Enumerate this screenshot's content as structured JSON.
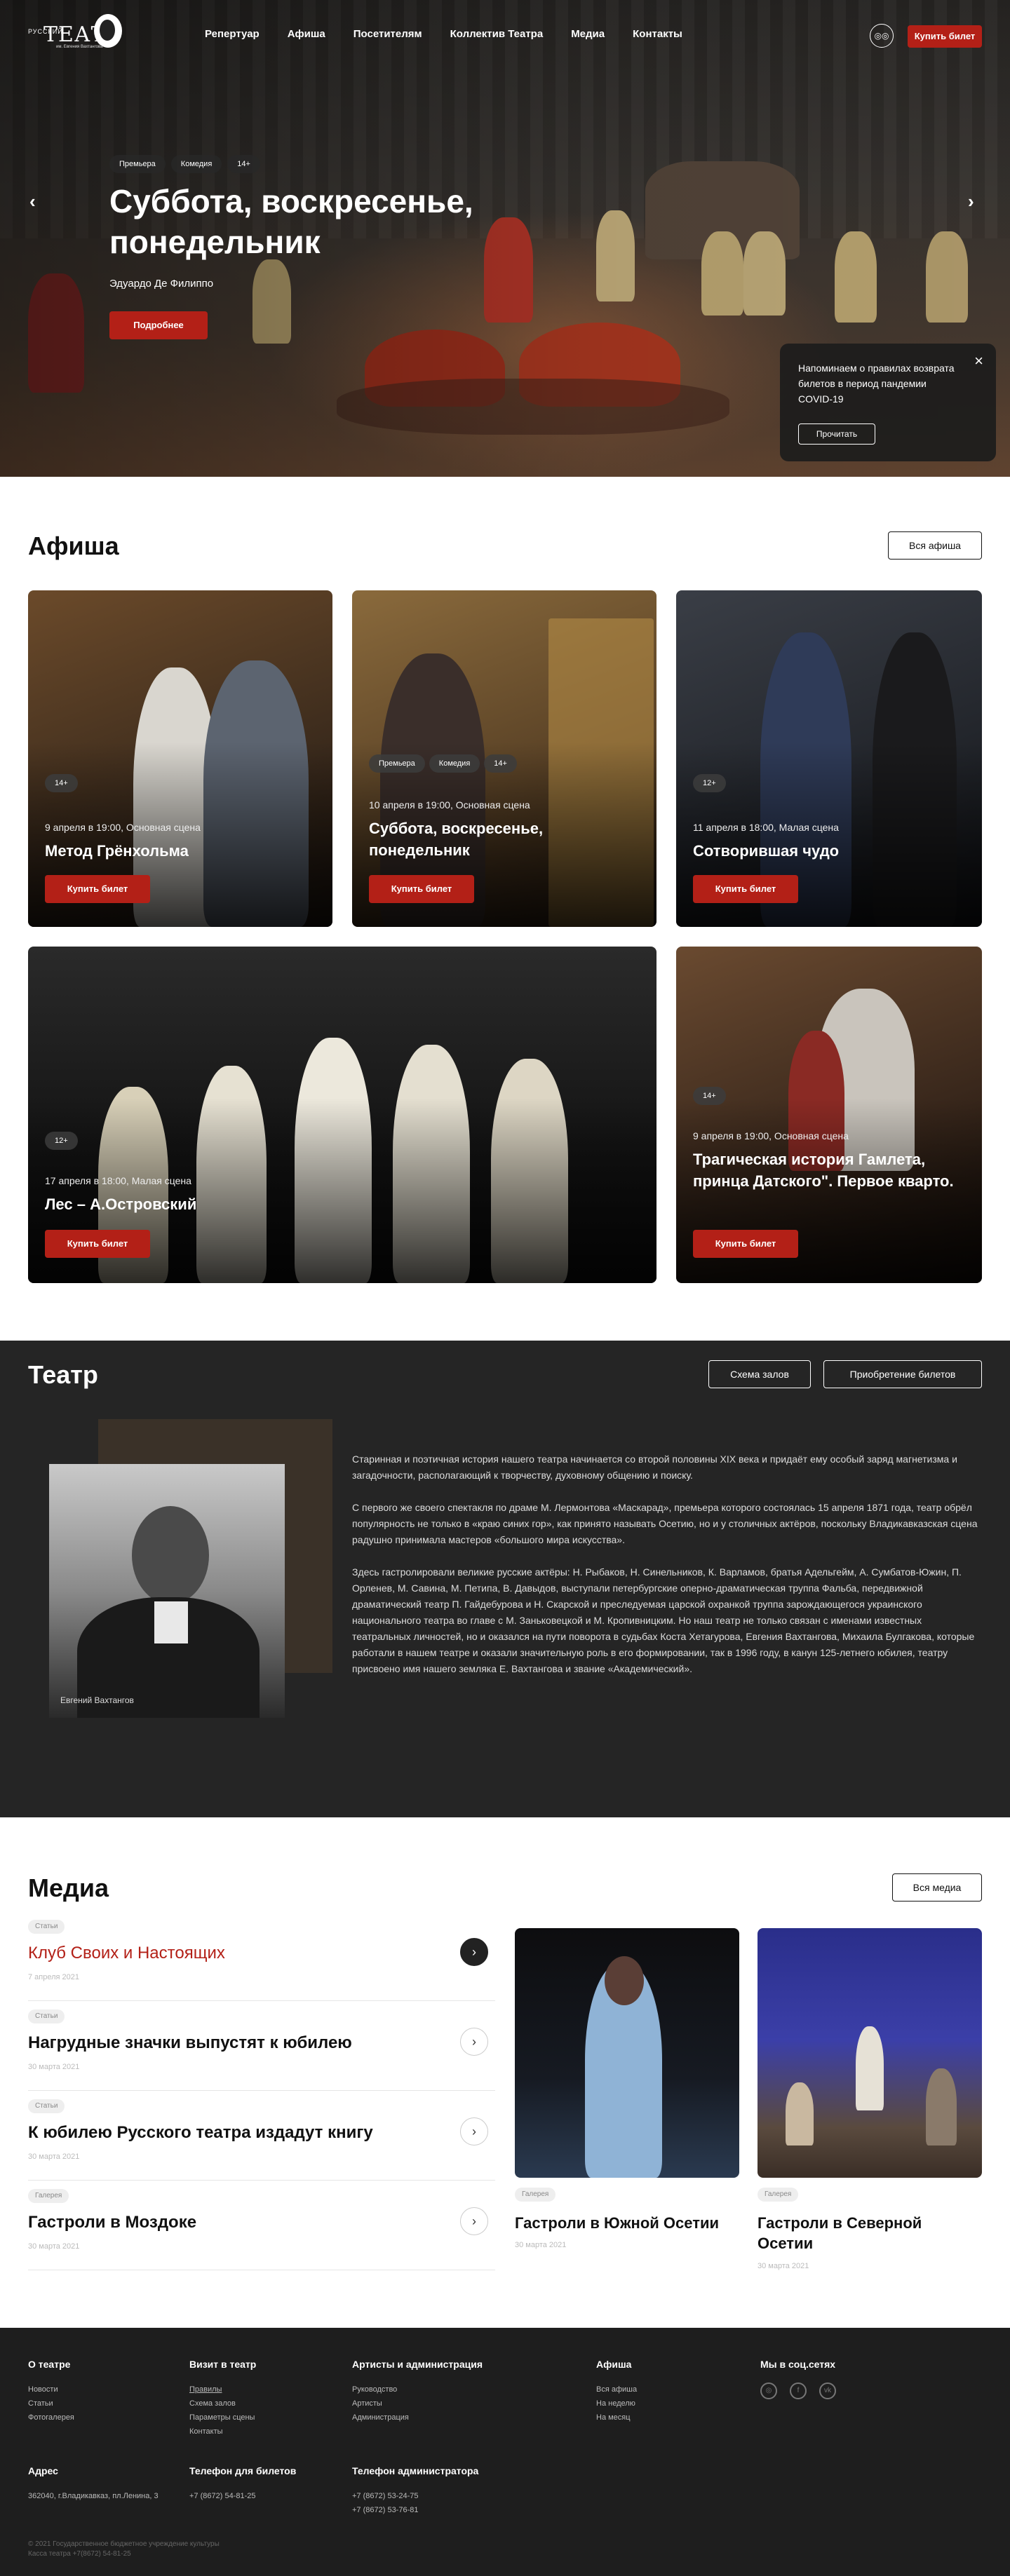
{
  "header": {
    "logo": {
      "small": "РУССКИЙ",
      "big": "ТЕАТР",
      "sub": "им. Евгения Вахтангова"
    },
    "nav": [
      "Репертуар",
      "Афиша",
      "Посетителям",
      "Коллектив Театра",
      "Медиа",
      "Контакты"
    ],
    "accessibility_icon": "glasses-icon",
    "buy_ticket": "Купить билет"
  },
  "hero": {
    "tags": [
      "Премьера",
      "Комедия",
      "14+"
    ],
    "title": "Суббота, воскресенье, понедельник",
    "author": "Эдуардо Де Филиппо",
    "more": "Подробнее",
    "prev": "‹",
    "next": "›"
  },
  "notice": {
    "text": "Напоминаем о правилах возврата билетов в период пандемии COVID-19",
    "read": "Прочитать",
    "close": "×"
  },
  "afisha": {
    "title": "Афиша",
    "all": "Вся афиша",
    "cards": [
      {
        "tags": [
          "14+"
        ],
        "date": "9 апреля в 19:00, Основная сцена",
        "title": "Метод Грёнхольма",
        "buy": "Купить билет"
      },
      {
        "tags": [
          "Премьера",
          "Комедия",
          "14+"
        ],
        "date": "10 апреля в 19:00, Основная сцена",
        "title": "Суббота, воскресенье, понедельник",
        "buy": "Купить билет"
      },
      {
        "tags": [
          "12+"
        ],
        "date": "11 апреля в 18:00, Малая сцена",
        "title": "Сотворившая чудо",
        "buy": "Купить билет"
      },
      {
        "tags": [
          "12+"
        ],
        "date": "17 апреля в 18:00, Малая сцена",
        "title": "Лес – А.Островский",
        "buy": "Купить билет"
      },
      {
        "tags": [
          "14+"
        ],
        "date": "9 апреля в 19:00, Основная сцена",
        "title": "Трагическая история Гамлета, принца Датского\". Первое кварто.",
        "buy": "Купить билет"
      }
    ]
  },
  "theatre": {
    "title": "Театр",
    "halls": "Схема залов",
    "tickets": "Приобретение билетов",
    "caption": "Евгений Вахтангов",
    "paragraphs": [
      "Старинная и поэтичная история нашего театра начинается со второй половины XIX века и придаёт ему особый заряд магнетизма и загадочности, располагающий к творчеству, духовному общению и поиску.",
      "С первого же своего спектакля по драме М. Лермонтова «Маскарад», премьера которого состоялась 15 апреля 1871 года, театр обрёл популярность не только в «краю синих гор», как принято называть Осетию, но и у столичных актёров, поскольку Владикавказская сцена радушно принимала мастеров «большого мира искусства».",
      "Здесь гастролировали великие русские актёры: Н. Рыбаков, Н. Синельников, К. Варламов, братья Адельгейм, А. Сумбатов-Южин, П. Орленев, М. Савина, М. Петипа, В. Давыдов, выступали петербургские оперно-драматическая труппа Фальба, передвижной драматический театр П. Гайдебурова и Н. Скарской и преследуемая царской охранкой труппа зарождающегося украинского национального театра во главе с М. Заньковецкой и М. Кропивницким. Но наш театр не только связан с именами известных театральных личностей, но и оказался на пути поворота в судьбах Коста Хетагурова, Евгения Вахтангова, Михаила Булгакова, которые работали в нашем театре и оказали значительную роль в его формировании, так в 1996 году, в канун 125-летнего юбилея, театру присвоено имя нашего земляка Е. Вахтангова и звание «Академический»."
    ]
  },
  "media": {
    "title": "Медиа",
    "all": "Вся медиа",
    "list": [
      {
        "tag": "Статьи",
        "title": "Клуб Своих и Настоящих",
        "date": "7 апреля 2021",
        "active": true
      },
      {
        "tag": "Статьи",
        "title": "Нагрудные значки выпустят к юбилею",
        "date": "30 марта 2021",
        "active": false
      },
      {
        "tag": "Статьи",
        "title": "К юбилею Русского театра издадут книгу",
        "date": "30 марта 2021",
        "active": false
      },
      {
        "tag": "Галерея",
        "title": "Гастроли в Моздоке",
        "date": "30 марта 2021",
        "active": false
      }
    ],
    "cards": [
      {
        "tag": "Галерея",
        "title": "Гастроли в Южной Осетии",
        "date": "30 марта 2021"
      },
      {
        "tag": "Галерея",
        "title": "Гастроли в Северной Осетии",
        "date": "30 марта 2021"
      }
    ],
    "arrow": "›"
  },
  "footer": {
    "cols": [
      {
        "title": "О театре",
        "links": [
          "Новости",
          "Статьи",
          "Фотогалерея"
        ]
      },
      {
        "title": "Визит в театр",
        "links": [
          "Правилы",
          "Схема залов",
          "Параметры сцены",
          "Контакты"
        ]
      },
      {
        "title": "Артисты и администрация",
        "links": [
          "Руководство",
          "Артисты",
          "Администрация"
        ]
      },
      {
        "title": "Афиша",
        "links": [
          "Вся афиша",
          "На неделю",
          "На месяц"
        ]
      },
      {
        "title": "Мы в соц.сетях",
        "links": []
      }
    ],
    "contacts": [
      {
        "title": "Адрес",
        "lines": [
          "362040, г.Владикавказ, пл.Ленина, 3"
        ]
      },
      {
        "title": "Телефон для билетов",
        "lines": [
          "+7 (8672) 54-81-25"
        ]
      },
      {
        "title": "Телефон администратора",
        "lines": [
          "+7 (8672) 53-24-75",
          "+7 (8672) 53-76-81"
        ]
      }
    ],
    "copyright": "© 2021 Государственное бюджетное учреждение культуры",
    "copyright2": "Касса театра +7(8672) 54-81-25",
    "social": [
      "instagram-icon",
      "facebook-icon",
      "vk-icon"
    ],
    "social_glyphs": [
      "◎",
      "f",
      "vk"
    ]
  },
  "colors": {
    "accent": "#b32017",
    "dark": "#252525",
    "footer": "#1e1e1e"
  }
}
